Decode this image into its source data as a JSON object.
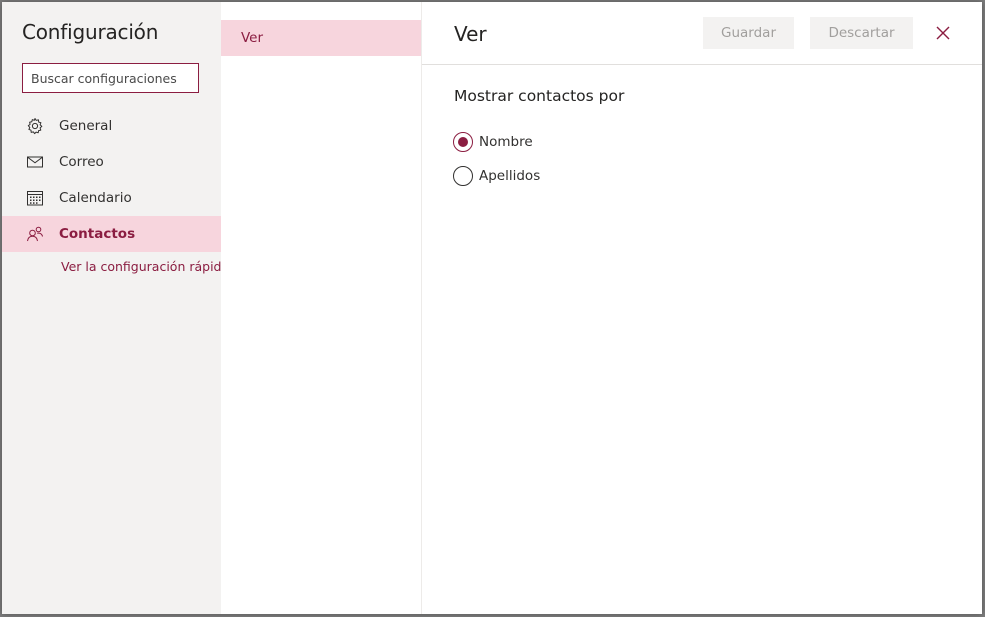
{
  "colors": {
    "accent": "#8b1d41",
    "selected_bg": "#f7d5dd",
    "nav_bg": "#f3f2f1"
  },
  "nav": {
    "title": "Configuración",
    "search_placeholder": "Buscar configuraciones",
    "items": [
      {
        "label": "General",
        "icon": "gear-icon",
        "selected": false
      },
      {
        "label": "Correo",
        "icon": "mail-icon",
        "selected": false
      },
      {
        "label": "Calendario",
        "icon": "calendar-icon",
        "selected": false
      },
      {
        "label": "Contactos",
        "icon": "people-icon",
        "selected": true
      }
    ],
    "quick_settings_link": "Ver la configuración rápida"
  },
  "subnav": {
    "items": [
      {
        "label": "Ver",
        "selected": true
      }
    ]
  },
  "content": {
    "title": "Ver",
    "save_label": "Guardar",
    "discard_label": "Descartar",
    "close_icon": "close-icon",
    "section_title": "Mostrar contactos por",
    "options": [
      {
        "label": "Nombre",
        "checked": true
      },
      {
        "label": "Apellidos",
        "checked": false
      }
    ]
  }
}
